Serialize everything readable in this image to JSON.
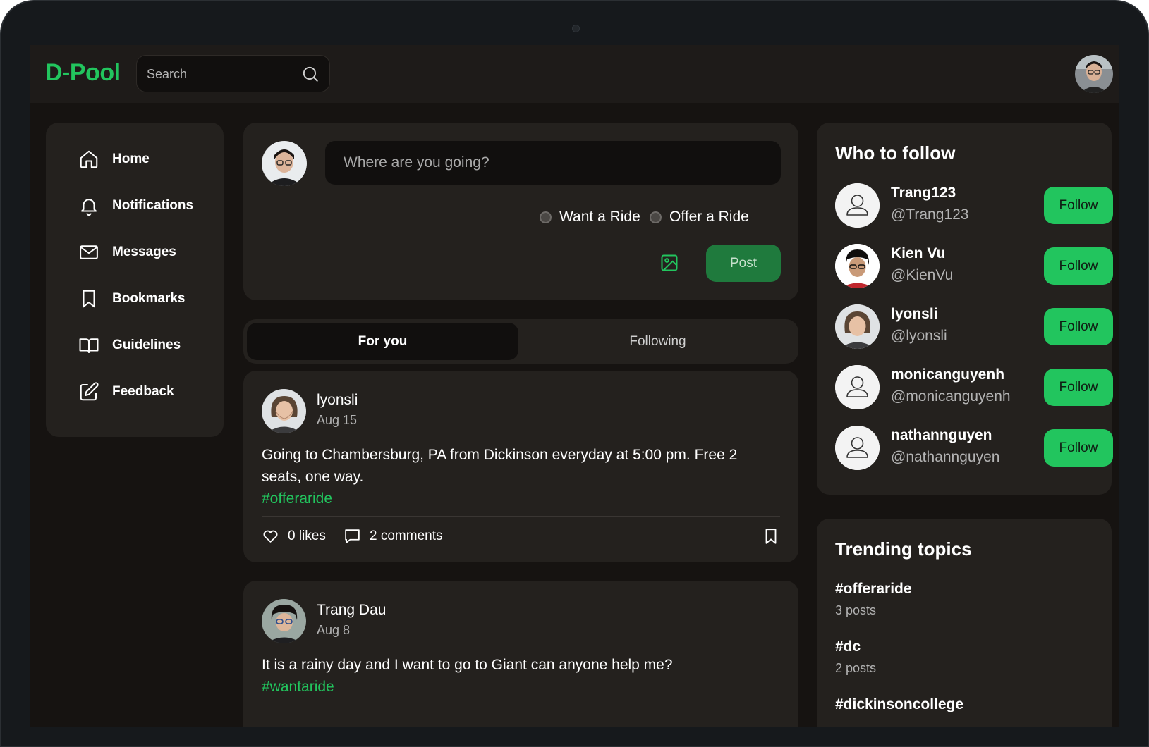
{
  "app": {
    "logo": "D-Pool"
  },
  "search": {
    "placeholder": "Search"
  },
  "sidebar": {
    "items": [
      {
        "label": "Home",
        "icon": "home-icon"
      },
      {
        "label": "Notifications",
        "icon": "bell-icon"
      },
      {
        "label": "Messages",
        "icon": "mail-icon"
      },
      {
        "label": "Bookmarks",
        "icon": "bookmark-icon"
      },
      {
        "label": "Guidelines",
        "icon": "book-open-icon"
      },
      {
        "label": "Feedback",
        "icon": "edit-icon"
      }
    ]
  },
  "composer": {
    "placeholder": "Where are you going?",
    "options": [
      "Want a Ride",
      "Offer a Ride"
    ],
    "post_label": "Post"
  },
  "feed": {
    "tabs": [
      "For you",
      "Following"
    ],
    "active_tab": "For you",
    "posts": [
      {
        "author": "lyonsli",
        "date": "Aug 15",
        "text": "Going to Chambersburg, PA from Dickinson everyday at 5:00 pm. Free 2 seats, one way.",
        "tag": "#offeraride",
        "likes": "0 likes",
        "comments": "2 comments"
      },
      {
        "author": "Trang Dau",
        "date": "Aug 8",
        "text": "It is a rainy day and I want to go to Giant can anyone help me?",
        "tag": "#wantaride"
      }
    ]
  },
  "who_to_follow": {
    "title": "Who to follow",
    "button_label": "Follow",
    "users": [
      {
        "name": "Trang123",
        "handle": "@Trang123",
        "avatar": "default-user-icon"
      },
      {
        "name": "Kien Vu",
        "handle": "@KienVu",
        "avatar": "photo"
      },
      {
        "name": "lyonsli",
        "handle": "@lyonsli",
        "avatar": "photo"
      },
      {
        "name": "monicanguyenh",
        "handle": "@monicanguyenh",
        "avatar": "default-user-icon"
      },
      {
        "name": "nathannguyen",
        "handle": "@nathannguyen",
        "avatar": "default-user-icon"
      }
    ]
  },
  "trending": {
    "title": "Trending topics",
    "topics": [
      {
        "tag": "#offeraride",
        "count": "3 posts"
      },
      {
        "tag": "#dc",
        "count": "2 posts"
      },
      {
        "tag": "#dickinsoncollege",
        "count": ""
      }
    ]
  },
  "colors": {
    "accent": "#22c55e",
    "post_button": "#1f7a3d",
    "card": "#24211e",
    "background": "#161311"
  }
}
